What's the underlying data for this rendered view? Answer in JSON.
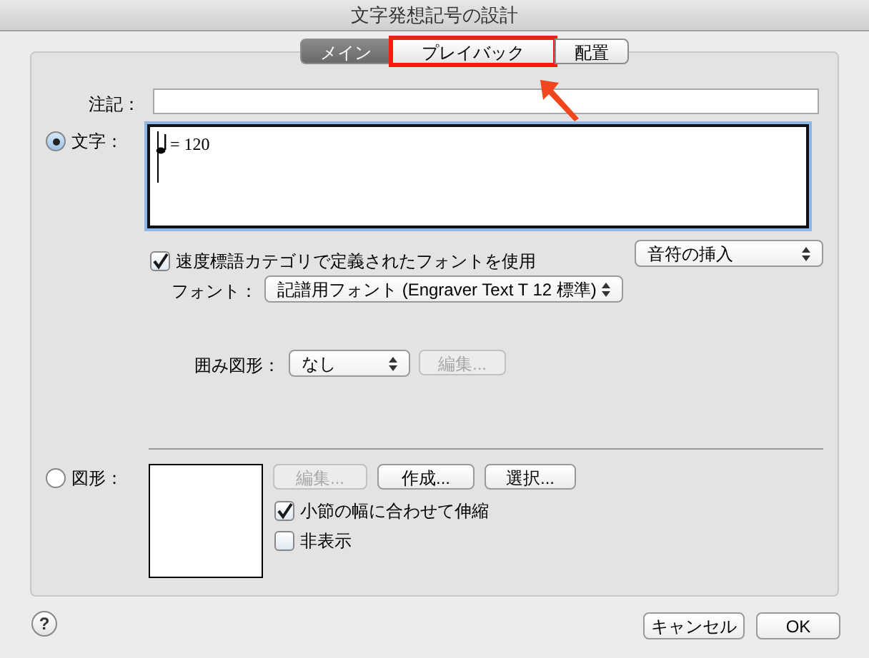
{
  "window": {
    "title": "文字発想記号の設計"
  },
  "tabs": [
    {
      "label": "メイン",
      "selected": true,
      "highlighted": false
    },
    {
      "label": "プレイバック",
      "selected": false,
      "highlighted": true
    },
    {
      "label": "配置",
      "selected": false,
      "highlighted": false
    }
  ],
  "annotation": {
    "label": "注記："
  },
  "text_option": {
    "label": "文字：",
    "selected": true,
    "value": "= 120"
  },
  "use_tempo_font": {
    "label": "速度標語カテゴリで定義されたフォントを使用",
    "checked": true
  },
  "insert_note_popup": {
    "value": "音符の挿入"
  },
  "font": {
    "label": "フォント：",
    "value": "記譜用フォント (Engraver Text T 12 標準)"
  },
  "enclosure": {
    "label": "囲み図形：",
    "value": "なし",
    "edit_button": {
      "label": "編集...",
      "disabled": true
    }
  },
  "shape_option": {
    "label": "図形：",
    "selected": false,
    "buttons": [
      {
        "label": "編集...",
        "disabled": true
      },
      {
        "label": "作成...",
        "disabled": false
      },
      {
        "label": "選択...",
        "disabled": false
      }
    ],
    "checkboxes": [
      {
        "label": "小節の幅に合わせて伸縮",
        "checked": true
      },
      {
        "label": "非表示",
        "checked": false
      }
    ]
  },
  "help_button": {
    "label": "?"
  },
  "buttons": [
    {
      "label": "キャンセル"
    },
    {
      "label": "OK"
    }
  ]
}
